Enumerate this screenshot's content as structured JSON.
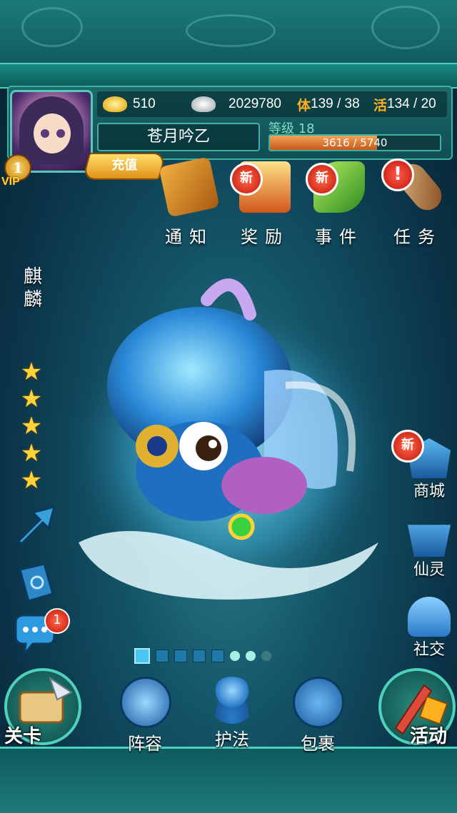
{
  "player": {
    "vip_level": "1",
    "vip_label": "VIP",
    "recharge_label": "充值",
    "gold": "510",
    "silver": "2029780",
    "stamina_label": "体",
    "stamina": "139 / 38",
    "vigor_label": "活",
    "vigor": "134 / 20",
    "name": "苍月吟乙",
    "level_label": "等级 18",
    "exp_text": "3616 / 5740",
    "exp_fraction": 0.63
  },
  "top_menu": [
    {
      "label": "通知",
      "badge": ""
    },
    {
      "label": "奖励",
      "badge": "新"
    },
    {
      "label": "事件",
      "badge": "新"
    },
    {
      "label": "任务",
      "badge": "!"
    }
  ],
  "pet": {
    "name_line1": "麒",
    "name_line2": "麟",
    "stars": 5
  },
  "left_tools": {
    "chat_badge": "1"
  },
  "right_menu": [
    {
      "label": "商城",
      "badge": "新"
    },
    {
      "label": "仙灵",
      "badge": ""
    },
    {
      "label": "社交",
      "badge": ""
    }
  ],
  "pager": {
    "pages": 8,
    "active": 1
  },
  "bottom_nav": {
    "stage": "关卡",
    "lineup": "阵容",
    "guard": "护法",
    "bag": "包裹",
    "event": "活动"
  },
  "colors": {
    "accent": "#4fd2bd",
    "gold": "#ffd23a",
    "badge_red": "#c2140a"
  }
}
